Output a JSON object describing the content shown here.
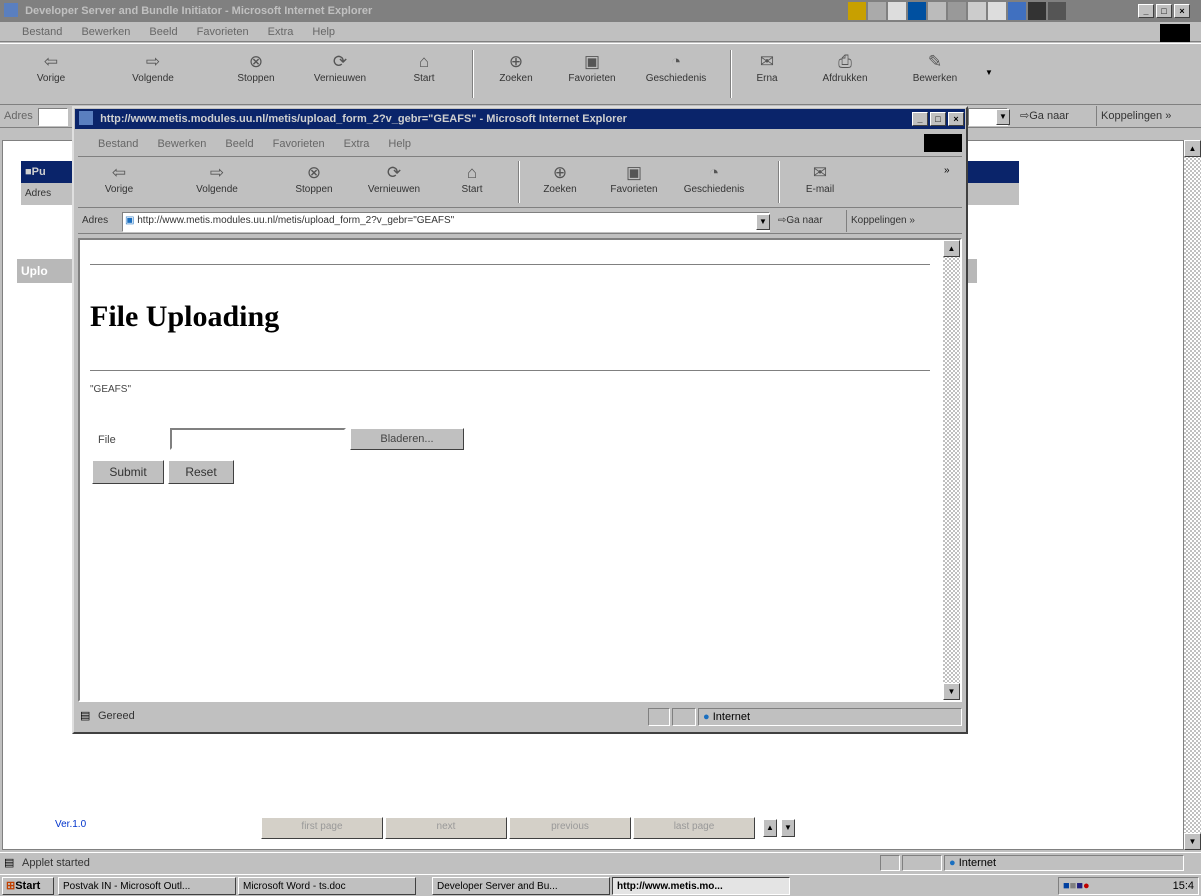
{
  "main_window": {
    "title": "Developer Server and Bundle Initiator - Microsoft Internet Explorer",
    "menu": [
      "Bestand",
      "Bewerken",
      "Beeld",
      "Favorieten",
      "Extra",
      "Help"
    ],
    "toolbar": [
      "Vorige",
      "Volgende",
      "Stoppen",
      "Vernieuwen",
      "Start",
      "Zoeken",
      "Favorieten",
      "Geschiedenis",
      "Erna",
      "Afdrukken",
      "Bewerken"
    ],
    "address_label": "Adres",
    "go_label": "Ga naar",
    "links_label": "Koppelingen",
    "status_text": "Applet started",
    "zone": "Internet",
    "version": "Ver.1.0",
    "page_buttons": [
      "first page",
      "next",
      "previous",
      "last page"
    ],
    "bg_title_fragment": "Pu",
    "bg_address_fragment": "Adres",
    "bg_tab_fragment": "Uplo"
  },
  "popup": {
    "title": "http://www.metis.modules.uu.nl/metis/upload_form_2?v_gebr=\"GEAFS\" - Microsoft Internet Explorer",
    "menu": [
      "Bestand",
      "Bewerken",
      "Beeld",
      "Favorieten",
      "Extra",
      "Help"
    ],
    "toolbar": [
      "Vorige",
      "Volgende",
      "Stoppen",
      "Vernieuwen",
      "Start",
      "Zoeken",
      "Favorieten",
      "Geschiedenis",
      "E-mail"
    ],
    "address_label": "Adres",
    "url": "http://www.metis.modules.uu.nl/metis/upload_form_2?v_gebr=\"GEAFS\"",
    "go_label": "Ga naar",
    "links_label": "Koppelingen",
    "heading": "File Uploading",
    "user_code": "\"GEAFS\"",
    "file_label": "File",
    "file_value": "",
    "browse_label": "Bladeren...",
    "submit_label": "Submit",
    "reset_label": "Reset",
    "status_text": "Gereed",
    "zone": "Internet"
  },
  "taskbar": {
    "start_label": "Start",
    "items": [
      {
        "label": "Postvak IN - Microsoft Outl..."
      },
      {
        "label": "Microsoft Word - ts.doc"
      },
      {
        "label": "Developer Server and Bu..."
      },
      {
        "label": "http://www.metis.mo..."
      }
    ],
    "clock": "15:4"
  }
}
